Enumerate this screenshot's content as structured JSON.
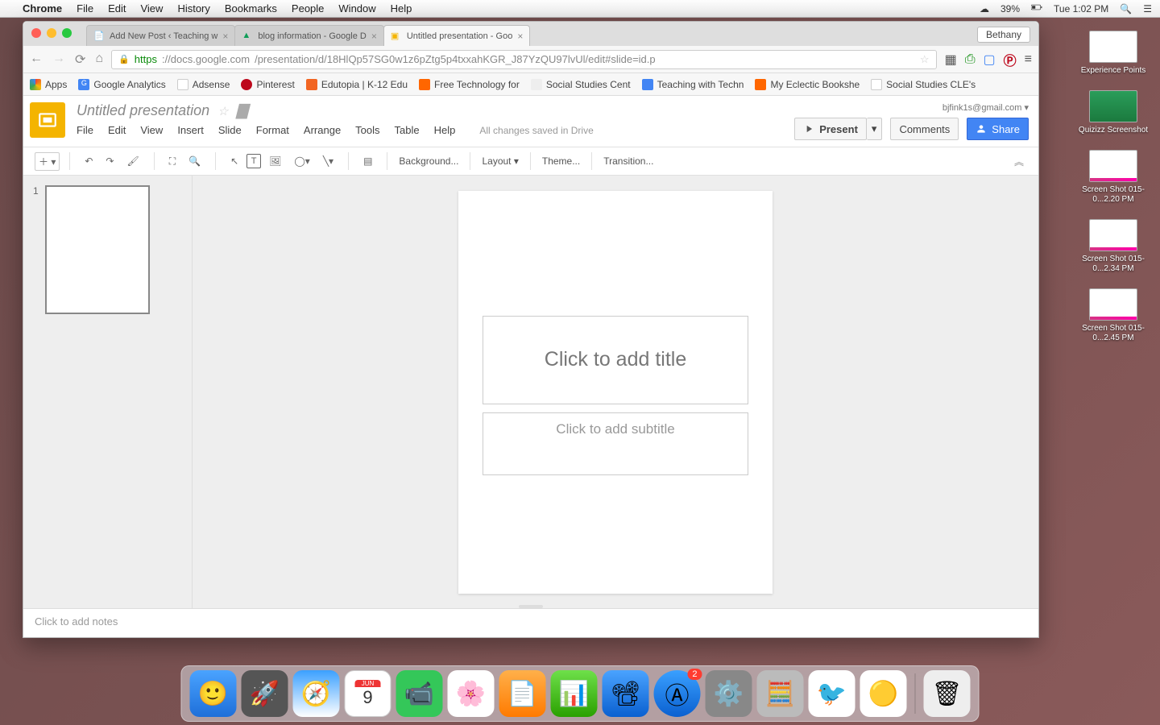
{
  "menubar": {
    "app": "Chrome",
    "items": [
      "File",
      "Edit",
      "View",
      "History",
      "Bookmarks",
      "People",
      "Window",
      "Help"
    ],
    "battery_pct": "39%",
    "clock": "Tue 1:02 PM"
  },
  "desktop_files": [
    {
      "label": "Experience Points",
      "variant": "plain"
    },
    {
      "label": "Quizizz Screenshot",
      "variant": "green"
    },
    {
      "label": "Screen Shot 015-0...2.20 PM",
      "variant": "pink"
    },
    {
      "label": "Screen Shot 015-0...2.34 PM",
      "variant": "pink"
    },
    {
      "label": "Screen Shot 015-0...2.45 PM",
      "variant": "pink"
    }
  ],
  "chrome": {
    "user": "Bethany",
    "tabs": [
      {
        "title": "Add New Post ‹ Teaching w"
      },
      {
        "title": "blog information - Google D"
      },
      {
        "title": "Untitled presentation - Goo"
      }
    ],
    "url": "https://docs.google.com/presentation/d/18HlQp57SG0w1z6pZtg5p4txxahKGR_J87YzQU97lvUl/edit#slide=id.p",
    "bookmarks": [
      "Apps",
      "Google Analytics",
      "Adsense",
      "Pinterest",
      "Edutopia | K-12 Edu",
      "Free Technology for",
      "Social Studies Cent",
      "Teaching with Techn",
      "My Eclectic Bookshe",
      "Social Studies CLE's"
    ]
  },
  "slides": {
    "doc_title": "Untitled presentation",
    "menus": [
      "File",
      "Edit",
      "View",
      "Insert",
      "Slide",
      "Format",
      "Arrange",
      "Tools",
      "Table",
      "Help"
    ],
    "saved": "All changes saved in Drive",
    "email": "bjfink1s@gmail.com",
    "present": "Present",
    "comments": "Comments",
    "share": "Share",
    "toolbar": {
      "background": "Background...",
      "layout": "Layout",
      "theme": "Theme...",
      "transition": "Transition..."
    },
    "title_placeholder": "Click to add title",
    "subtitle_placeholder": "Click to add subtitle",
    "notes_placeholder": "Click to add notes",
    "thumb_number": "1"
  }
}
